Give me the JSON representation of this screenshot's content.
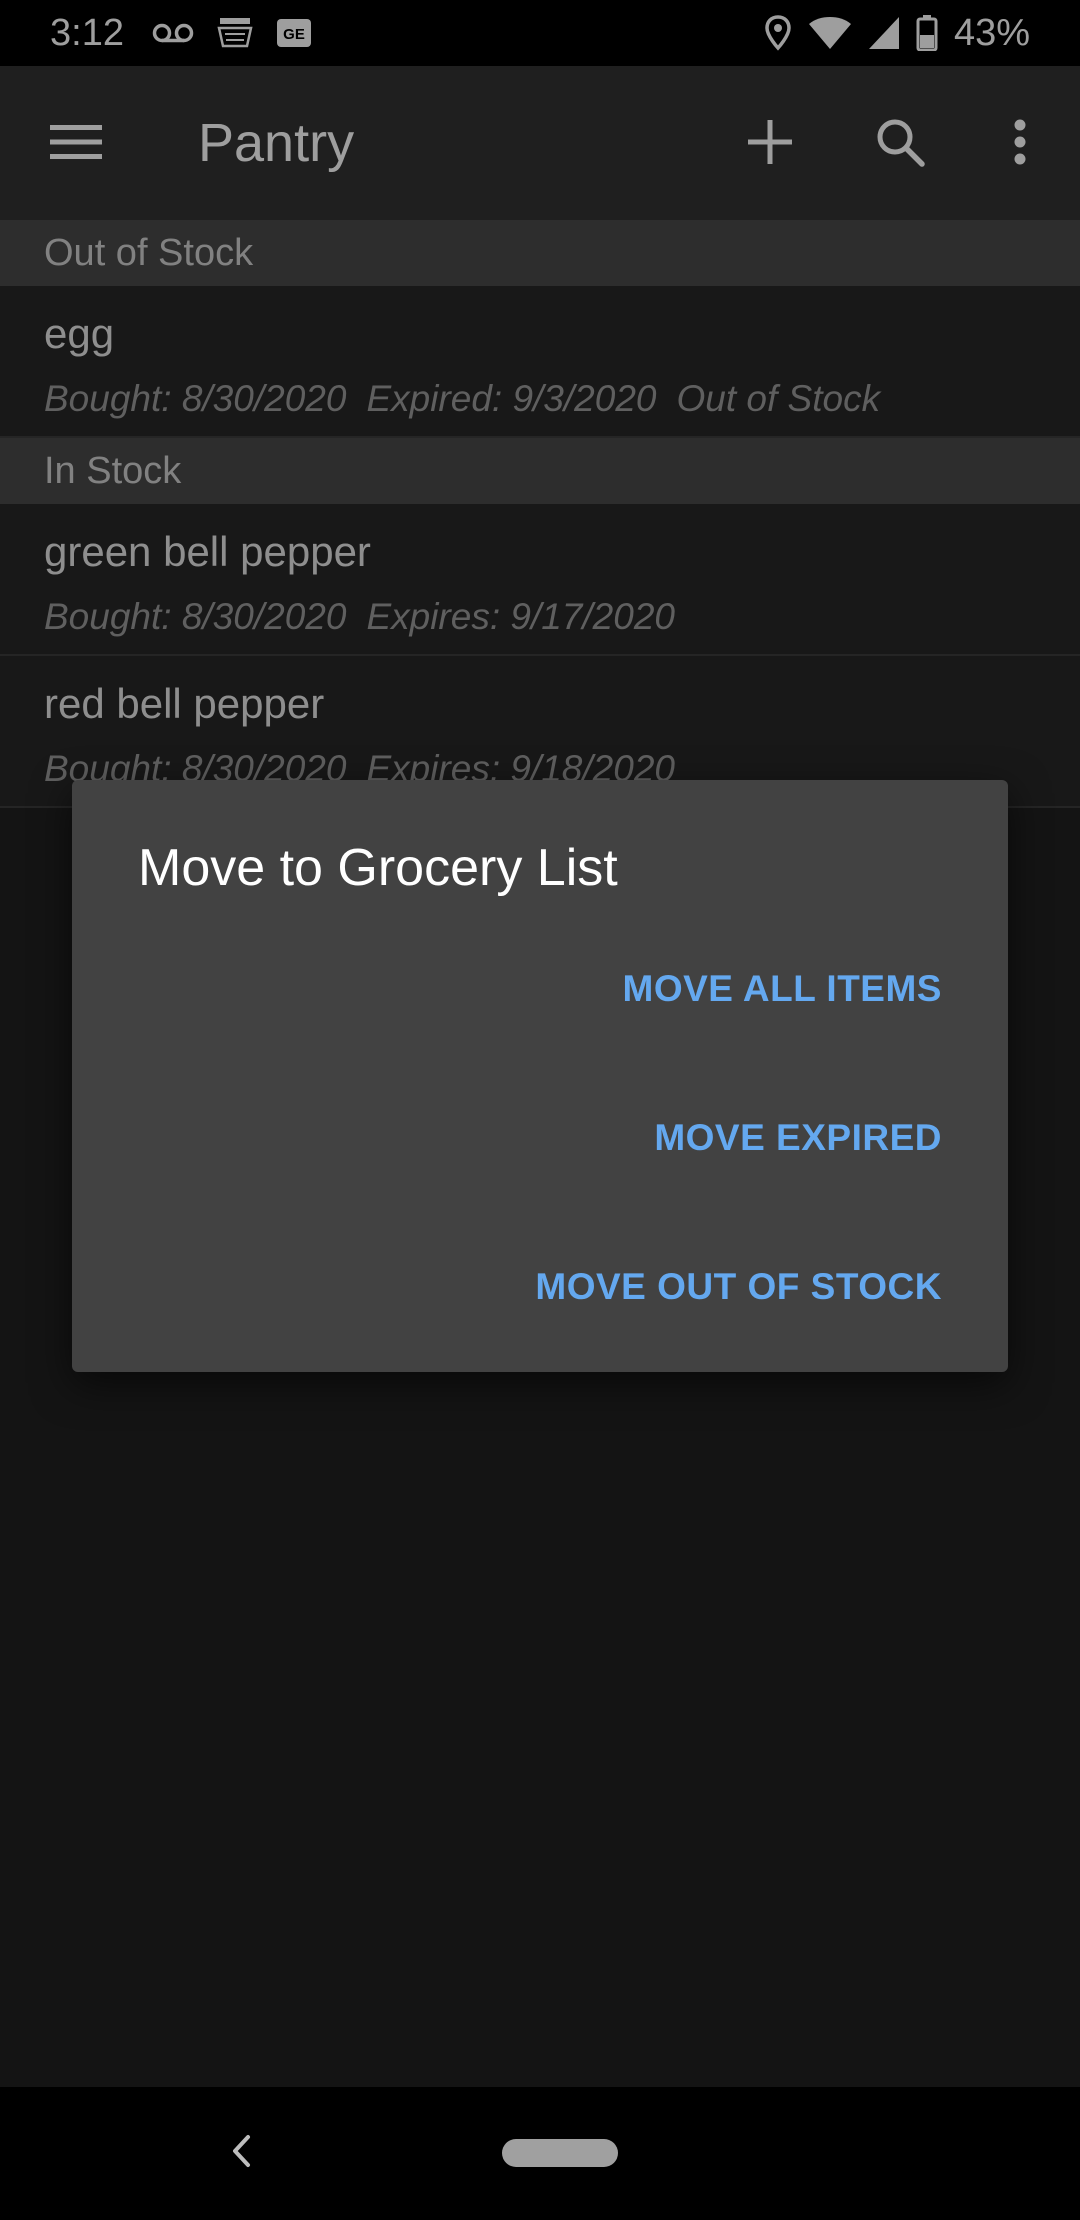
{
  "status_bar": {
    "time": "3:12",
    "battery_percent": "43%",
    "icons": [
      "voicemail-icon",
      "amazon-icon",
      "ge-icon",
      "location-icon",
      "wifi-icon",
      "signal-icon",
      "battery-icon"
    ]
  },
  "app_bar": {
    "title": "Pantry",
    "icons": [
      "menu-icon",
      "add-icon",
      "search-icon",
      "more-vert-icon"
    ]
  },
  "sections": [
    {
      "header": "Out of Stock",
      "items": [
        {
          "name": "egg",
          "bought": "Bought: 8/30/2020",
          "expiry": "Expired: 9/3/2020",
          "status": "Out of Stock"
        }
      ]
    },
    {
      "header": "In Stock",
      "items": [
        {
          "name": "green bell pepper",
          "bought": "Bought: 8/30/2020",
          "expiry": "Expires: 9/17/2020"
        },
        {
          "name": "red bell pepper",
          "bought": "Bought: 8/30/2020",
          "expiry": "Expires: 9/18/2020"
        }
      ]
    }
  ],
  "dialog": {
    "title": "Move to Grocery List",
    "buttons": {
      "move_all": "MOVE ALL ITEMS",
      "move_expired": "MOVE EXPIRED",
      "move_out_of_stock": "MOVE OUT OF STOCK"
    }
  },
  "colors": {
    "accent": "#64a8ef",
    "dialog_bg": "#424242",
    "app_bar": "#333333"
  }
}
